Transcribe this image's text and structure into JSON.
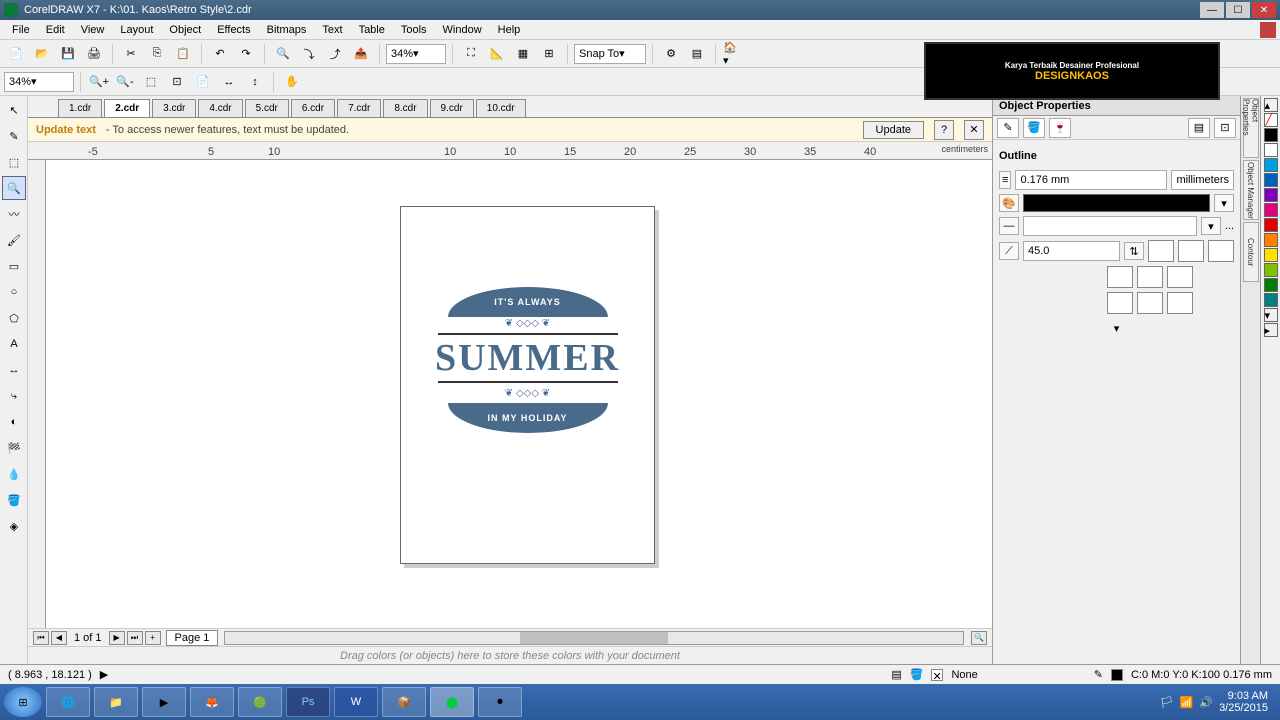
{
  "titlebar": {
    "text": "CorelDRAW X7 - K:\\01. Kaos\\Retro Style\\2.cdr"
  },
  "menubar": [
    "File",
    "Edit",
    "View",
    "Layout",
    "Object",
    "Effects",
    "Bitmaps",
    "Text",
    "Table",
    "Tools",
    "Window",
    "Help"
  ],
  "toolbar": {
    "zoom": "34%",
    "snap": "Snap To"
  },
  "toolbar2": {
    "zoom": "34%"
  },
  "doctabs": [
    "1.cdr",
    "2.cdr",
    "3.cdr",
    "4.cdr",
    "5.cdr",
    "6.cdr",
    "7.cdr",
    "8.cdr",
    "9.cdr",
    "10.cdr"
  ],
  "doctab_active": 1,
  "updatebar": {
    "label": "Update text",
    "msg": "- To access newer features, text must be updated.",
    "btn": "Update"
  },
  "ruler": {
    "units": "centimeters",
    "ticks_h": [
      "-5",
      "",
      "5",
      "10",
      "15",
      "20",
      "25",
      "30",
      "35",
      "40"
    ]
  },
  "design": {
    "top": "IT'S ALWAYS",
    "main": "SUMMER",
    "bot": "IN MY HOLIDAY",
    "orn": "❦ ◇◇◇ ❦"
  },
  "pagenav": {
    "count": "1 of 1",
    "tab": "Page 1"
  },
  "colorwell": "Drag colors (or objects) here to store these colors with your document",
  "status": {
    "coords": "( 8.963 , 18.121 )",
    "fill": "C:0 M:0 Y:0 K:100  0.176 mm",
    "none": "None"
  },
  "rightpanel": {
    "title": "Object Properties",
    "section": "Outline",
    "width_val": "0.176 mm",
    "units": "millimeters",
    "more": "...",
    "angle_val": "45.0"
  },
  "dockers": [
    "Object Properties",
    "Object Manager",
    "Contour"
  ],
  "palette": [
    "#ffffff",
    "#000000",
    "#00a0e0",
    "#e00000",
    "#ff8000",
    "#ffe000",
    "#80c000",
    "#008000",
    "#a060c0",
    "#c0c0c0"
  ],
  "banner_text": "DESIGNKAOS",
  "banner_sub": "Karya Terbaik Desainer Profesional",
  "tray": {
    "time": "9:03 AM",
    "date": "3/25/2015"
  }
}
